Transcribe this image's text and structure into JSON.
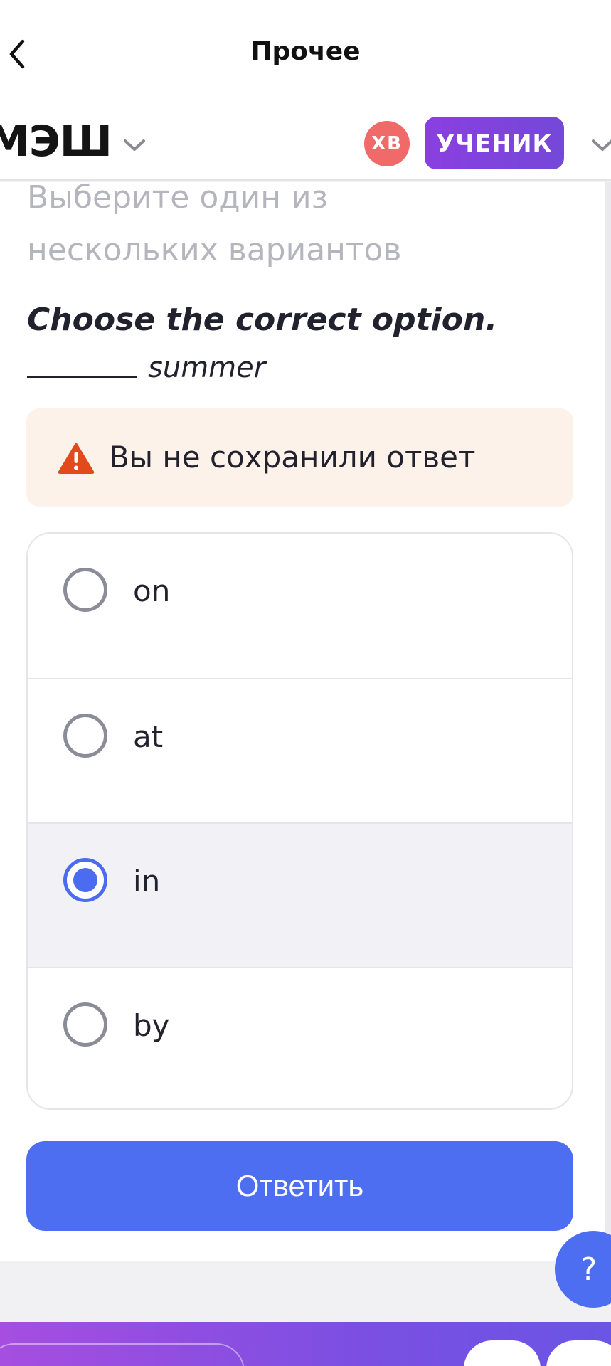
{
  "topbar": {
    "title": "Прочее"
  },
  "header": {
    "logo": "МЭШ",
    "avatar_initials": "ХВ",
    "role_badge": "УЧЕНИК"
  },
  "task": {
    "instruction": "Выберите один из нескольких вариантов",
    "question": "Choose the correct option.",
    "blank_word": "summer",
    "warning": "Вы не сохранили ответ",
    "options": [
      {
        "label": "on",
        "selected": false
      },
      {
        "label": "at",
        "selected": false
      },
      {
        "label": "in",
        "selected": true
      },
      {
        "label": "by",
        "selected": false
      }
    ],
    "submit_label": "Ответить"
  },
  "help": {
    "label": "?"
  },
  "colors": {
    "accent": "#4e6ef2",
    "badge": "#8a3fe0",
    "avatar": "#f06a6a",
    "warning_bg": "#fdf2ea",
    "warning_icon": "#e24a1c"
  },
  "icons": [
    "back-arrow-icon",
    "chevron-down-icon",
    "warning-icon",
    "radio-icon",
    "help-icon"
  ]
}
